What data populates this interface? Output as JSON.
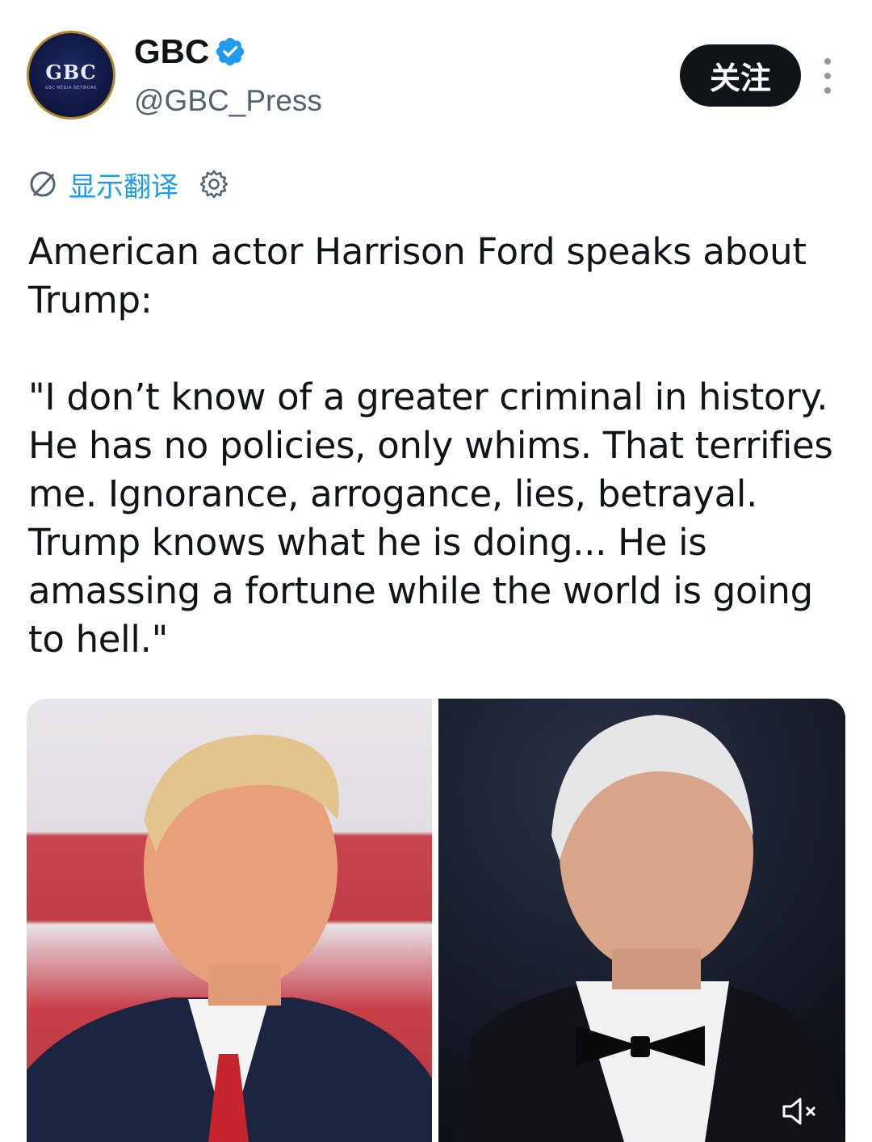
{
  "account": {
    "display_name": "GBC",
    "handle": "@GBC_Press",
    "avatar_logo_text": "GBC",
    "avatar_subtext": "GBC MEDIA NETWORK",
    "verified": true,
    "accent_color": "#1d9bf0"
  },
  "actions": {
    "follow_label": "关注",
    "more_icon": "more-vertical-icon"
  },
  "translate": {
    "label": "显示翻译",
    "icon": "globe-icon",
    "settings_icon": "settings-icon"
  },
  "tweet": {
    "text": "American actor Harrison Ford speaks about Trump:\n\n\"I don’t know of a greater criminal in history. He has no policies, only whims. That terrifies me. Ignorance, arrogance, lies, betrayal. Trump knows what he is doing... He is amassing a fortune while the world is going to hell.\""
  },
  "media": {
    "photos": [
      {
        "subject": "trump-photo"
      },
      {
        "subject": "harrison-ford-photo"
      }
    ],
    "mute_icon": "muted-speaker-icon"
  }
}
